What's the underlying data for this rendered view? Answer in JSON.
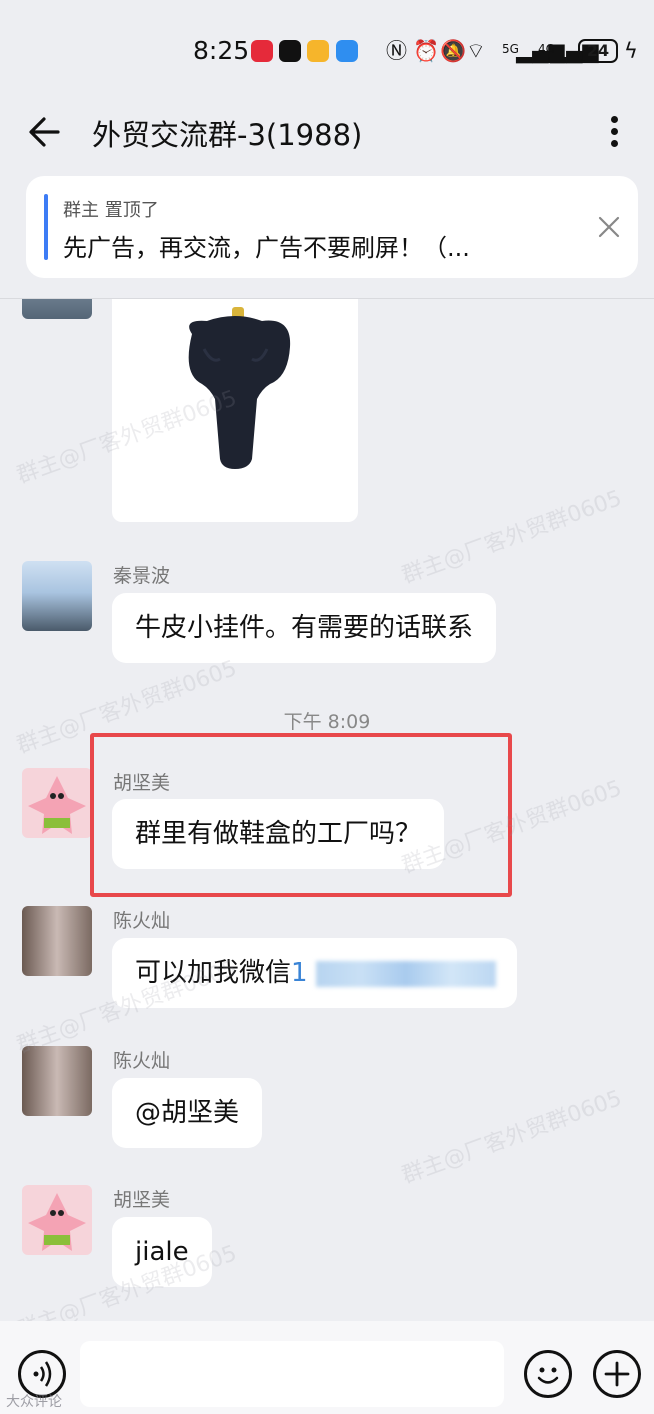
{
  "status_bar": {
    "time": "8:25",
    "battery": "24",
    "signal_labels": [
      "5G",
      "4G"
    ],
    "icons": [
      "nfc-icon",
      "alarm-icon",
      "mute-icon",
      "wifi-icon",
      "signal-5g-icon",
      "signal-4g-icon",
      "charging-icon"
    ]
  },
  "header": {
    "title": "外贸交流群-3(1988)",
    "back_icon": "arrow-left-icon",
    "more_icon": "more-vertical-icon"
  },
  "pinned": {
    "meta": "群主 置顶了",
    "text": "先广告，再交流，广告不要刷屏！（...",
    "close_icon": "close-icon"
  },
  "messages": [
    {
      "type": "image",
      "description_icon": "elephant-pendant-image"
    },
    {
      "type": "text",
      "sender": "秦景波",
      "text": "牛皮小挂件。有需要的话联系"
    },
    {
      "type": "time",
      "text": "下午 8:09"
    },
    {
      "type": "text",
      "sender": "胡坚美",
      "text": "群里有做鞋盒的工厂吗？",
      "highlighted": true
    },
    {
      "type": "text",
      "sender": "陈火灿",
      "text": "可以加我微信",
      "number_prefix": "1"
    },
    {
      "type": "text",
      "sender": "陈火灿",
      "text": "@胡坚美"
    },
    {
      "type": "text",
      "sender": "胡坚美",
      "text": "jiale"
    }
  ],
  "watermark": "群主@厂客外贸群0605",
  "corner_mark": "大众评论",
  "colors": {
    "accent": "#3d7cf5",
    "highlight": "#e8484b",
    "background": "#edeef2"
  }
}
